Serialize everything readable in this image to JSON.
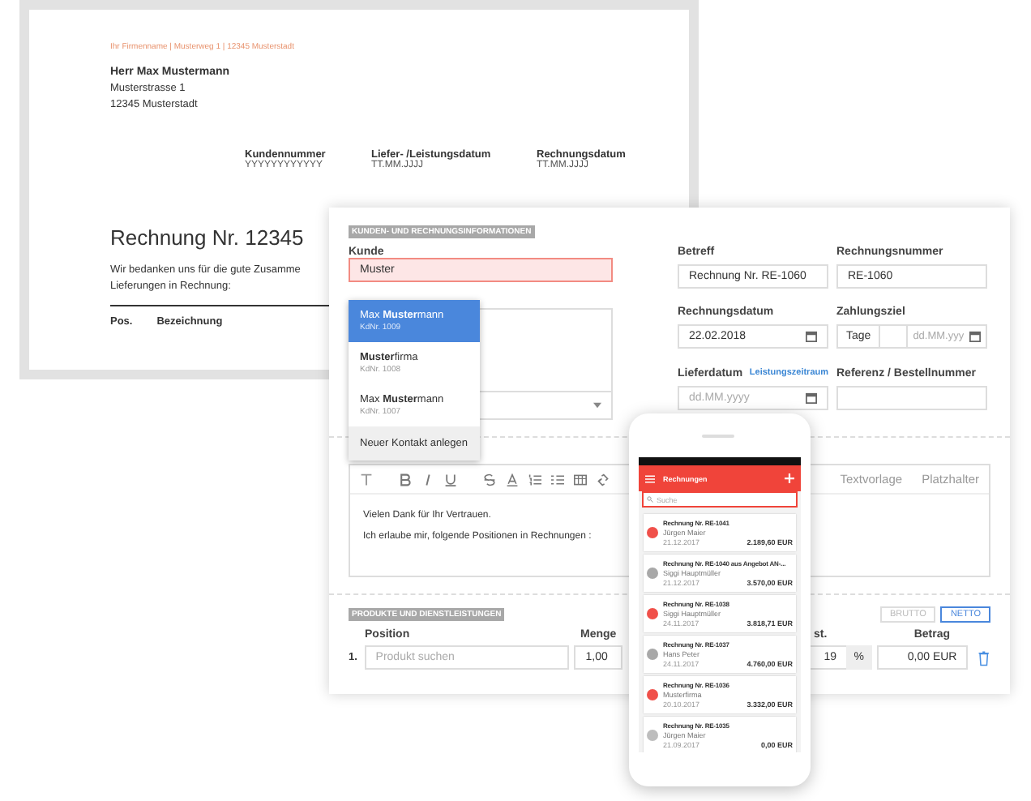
{
  "invoice_document": {
    "sender_line": "Ihr Firmenname | Musterweg 1 | 12345 Musterstadt",
    "recipient": [
      "Herr Max Mustermann",
      "Musterstrasse 1",
      "12345 Musterstadt"
    ],
    "meta": [
      {
        "label": "Kundennummer",
        "value": "YYYYYYYYYYYY"
      },
      {
        "label": "Liefer- /Leistungsdatum",
        "value": "TT.MM.JJJJ"
      },
      {
        "label": "Rechnungsdatum",
        "value": "TT.MM.JJJJ"
      }
    ],
    "heading": "Rechnung Nr. 12345",
    "intro": [
      "Wir bedanken uns für die gute Zusamme",
      "Lieferungen in Rechnung:"
    ],
    "columns": [
      "Pos.",
      "Bezeichnung"
    ]
  },
  "invoice_form": {
    "section_customer": "KUNDEN- UND RECHNUNGSINFORMATIONEN",
    "customer": {
      "label": "Kunde",
      "value": "Muster",
      "invalid": true
    },
    "suggestions": [
      {
        "name": "Max **Muster**mann",
        "number": "KdNr. 1009",
        "selected": true
      },
      {
        "name": "**Muster**firma",
        "number": "KdNr. 1008",
        "selected": false
      },
      {
        "name": "Max **Muster**mann",
        "number": "KdNr. 1007",
        "selected": false
      }
    ],
    "new_contact": "Neuer Kontakt anlegen",
    "fields": [
      {
        "label": "Betreff",
        "value": "Rechnung Nr. RE-1060"
      },
      {
        "label": "Rechnungsnummer",
        "value": "RE-1060"
      }
    ],
    "invoice_date": {
      "label": "Rechnungsdatum",
      "value": "22.02.2018"
    },
    "payment_term": {
      "label": "Zahlungsziel",
      "addon": "Tage",
      "placeholder": "dd.MM.yyy"
    },
    "delivery_date": {
      "label": "Lieferdatum",
      "link": "Leistungszeitraum",
      "placeholder": "dd.MM.yyyy"
    },
    "reference": {
      "label": "Referenz / Bestellnummer"
    },
    "editor": {
      "tabs": [
        "Textvorlage",
        "Platzhalter"
      ],
      "lines": [
        "Vielen Dank für Ihr Vertrauen.",
        "Ich erlaube mir, folgende Positionen in Rechnungen :"
      ]
    },
    "section_products": "PRODUKTE UND DIENSTLEISTUNGEN",
    "price_modes": [
      {
        "label": "BRUTTO",
        "selected": false
      },
      {
        "label": "NETTO",
        "selected": true
      }
    ],
    "columns": [
      "Position",
      "Menge",
      "st.",
      "Betrag"
    ],
    "row": {
      "index": "1.",
      "placeholder": "Produkt suchen",
      "quantity": "1,00",
      "tax": "19",
      "unit": "%",
      "amount": "0,00 EUR"
    }
  },
  "phone_app": {
    "title": "Rechnungen",
    "search_placeholder": "Suche",
    "invoices": [
      {
        "title": "Rechnung Nr. RE-1041",
        "customer": "Jürgen Maier",
        "date": "21.12.2017",
        "amount": "2.189,60 EUR",
        "color": "#f0504a"
      },
      {
        "title": "Rechnung Nr. RE-1040 aus Angebot AN-...",
        "customer": "Siggi Hauptmüller",
        "date": "21.12.2017",
        "amount": "3.570,00 EUR",
        "color": "#a8a8a8"
      },
      {
        "title": "Rechnung Nr. RE-1038",
        "customer": "Siggi Hauptmüller",
        "date": "24.11.2017",
        "amount": "3.818,71 EUR",
        "color": "#f0504a"
      },
      {
        "title": "Rechnung Nr. RE-1037",
        "customer": "Hans Peter",
        "date": "24.11.2017",
        "amount": "4.760,00 EUR",
        "color": "#a8a8a8"
      },
      {
        "title": "Rechnung Nr. RE-1036",
        "customer": "Musterfirma",
        "date": "20.10.2017",
        "amount": "3.332,00 EUR",
        "color": "#f0504a"
      },
      {
        "title": "Rechnung Nr. RE-1035",
        "customer": "Jürgen Maier",
        "date": "21.09.2017",
        "amount": "0,00 EUR",
        "color": "#bdbdbd"
      }
    ]
  }
}
